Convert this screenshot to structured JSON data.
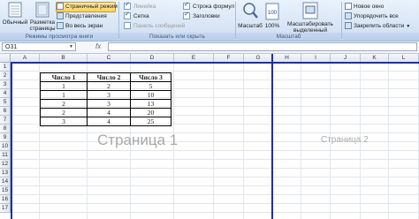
{
  "ribbon": {
    "view_modes": {
      "normal": "Обычный",
      "page_layout_1": "Разметка",
      "page_layout_2": "страницы",
      "page_break_preview": "Страничный режим",
      "custom_views": "Представления",
      "full_screen": "Во весь экран",
      "group_label": "Режимы просмотра книги"
    },
    "show_hide": {
      "ruler": "Линейка",
      "grid": "Сетка",
      "message_bar": "Панель сообщений",
      "formula_bar": "Строка формул",
      "headings": "Заголовки",
      "group_label": "Показать или скрыть"
    },
    "zoom": {
      "zoom": "Масштаб",
      "hundred": "100%",
      "zoom_sel_1": "Масштабировать",
      "zoom_sel_2": "выделенный фрагмент",
      "group_label": "Масштаб"
    },
    "window": {
      "new_window": "Новое окно",
      "arrange_all": "Упорядочить все",
      "freeze_panes": "Закрепить области"
    }
  },
  "formula_bar": {
    "name_box": "O31",
    "fx": "fx"
  },
  "columns": [
    "A",
    "B",
    "C",
    "D",
    "E",
    "F",
    "G",
    "H",
    "I",
    "J",
    "K",
    "L"
  ],
  "rows": [
    "1",
    "2",
    "3",
    "4",
    "5",
    "6",
    "7",
    "8",
    "9",
    "10",
    "11",
    "12",
    "13",
    "14",
    "15",
    "16",
    "17"
  ],
  "table": {
    "headers": [
      "Число 1",
      "Число 2",
      "Число 3"
    ],
    "rows": [
      [
        "1",
        "2",
        "5"
      ],
      [
        "1",
        "3",
        "10"
      ],
      [
        "2",
        "3",
        "13"
      ],
      [
        "2",
        "4",
        "20"
      ],
      [
        "3",
        "4",
        "25"
      ]
    ]
  },
  "watermarks": {
    "page1": "Страница 1",
    "page2": "Страница 2"
  },
  "colors": {
    "page_break": "#1f2fa8",
    "ribbon": "#d6e4f5"
  }
}
